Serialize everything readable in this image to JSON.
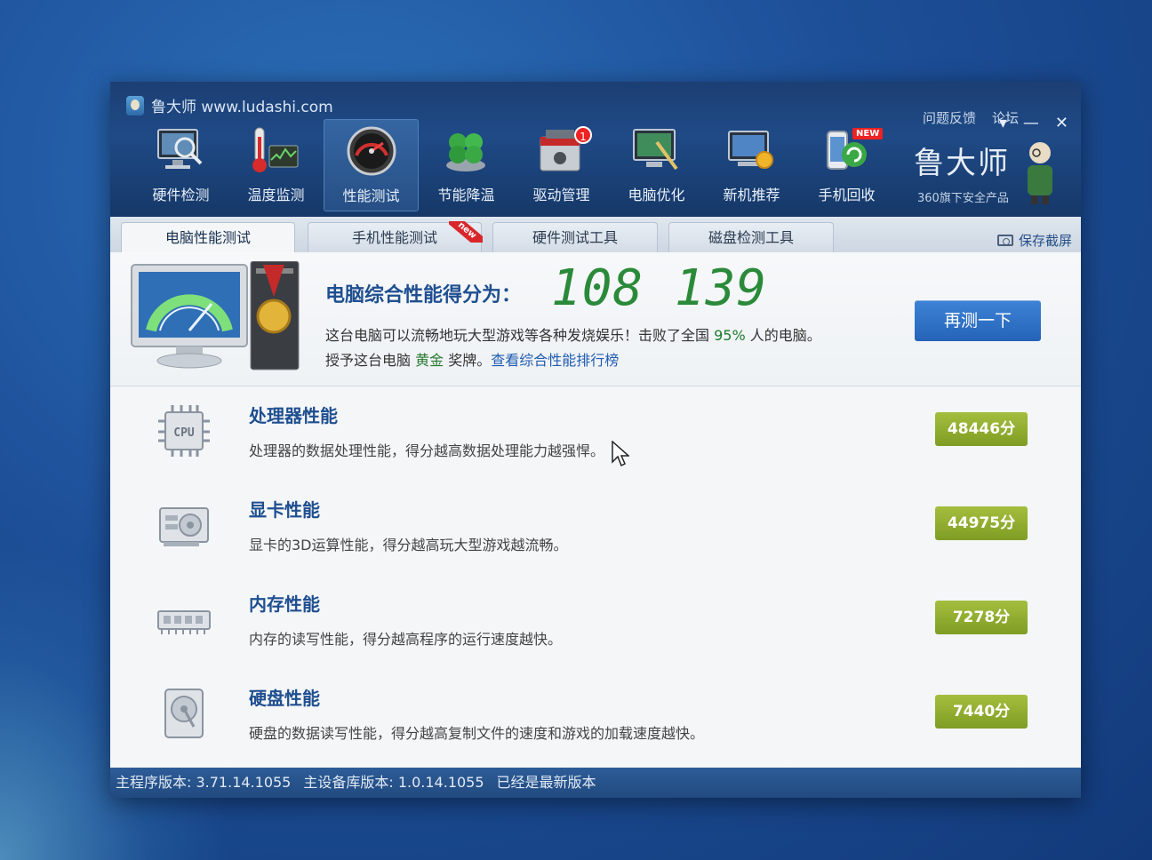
{
  "window": {
    "title": "鲁大师 www.ludashi.com"
  },
  "top_links": {
    "feedback": "问题反馈",
    "forum": "论坛"
  },
  "window_controls": {
    "menu": "▾",
    "minimize": "—",
    "close": "✕"
  },
  "nav": {
    "items": [
      {
        "label": "硬件检测",
        "icon": "hardware-monitor-icon"
      },
      {
        "label": "温度监测",
        "icon": "thermometer-icon"
      },
      {
        "label": "性能测试",
        "icon": "speedometer-icon",
        "active": true
      },
      {
        "label": "节能降温",
        "icon": "clover-leaf-icon"
      },
      {
        "label": "驱动管理",
        "icon": "driver-toolbox-icon",
        "badge": "1"
      },
      {
        "label": "电脑优化",
        "icon": "broom-monitor-icon"
      },
      {
        "label": "新机推荐",
        "icon": "new-pc-medal-icon"
      },
      {
        "label": "手机回收",
        "icon": "phone-recycle-icon",
        "badge": "NEW"
      }
    ]
  },
  "brand": {
    "name": "鲁大师",
    "subtitle": "360旗下安全产品"
  },
  "tabs": [
    {
      "label": "电脑性能测试",
      "active": true
    },
    {
      "label": "手机性能测试",
      "corner": "new"
    },
    {
      "label": "硬件测试工具"
    },
    {
      "label": "磁盘检测工具"
    }
  ],
  "save_screenshot": "保存截屏",
  "summary": {
    "title": "电脑综合性能得分为：",
    "score": "108 139",
    "line1_a": "这台电脑可以流畅地玩大型游戏等各种发烧娱乐！击败了全国",
    "line1_pct": "95%",
    "line1_b": "人的电脑。",
    "line2_a": "授予这台电脑",
    "line2_medal": "黄金",
    "line2_b": "奖牌。",
    "line2_link": "查看综合性能排行榜",
    "retest_button": "再测一下"
  },
  "rows": [
    {
      "title": "处理器性能",
      "desc": "处理器的数据处理性能，得分越高数据处理能力越强悍。",
      "score": "48446分",
      "icon": "cpu-chip-icon",
      "icon_text": "CPU"
    },
    {
      "title": "显卡性能",
      "desc": "显卡的3D运算性能，得分越高玩大型游戏越流畅。",
      "score": "44975分",
      "icon": "graphics-card-icon"
    },
    {
      "title": "内存性能",
      "desc": "内存的读写性能，得分越高程序的运行速度越快。",
      "score": "7278分",
      "icon": "memory-stick-icon"
    },
    {
      "title": "硬盘性能",
      "desc": "硬盘的数据读写性能，得分越高复制文件的速度和游戏的加载速度越快。",
      "score": "7440分",
      "icon": "hard-disk-icon"
    }
  ],
  "status": {
    "main_version": "主程序版本: 3.71.14.1055",
    "db_version": "主设备库版本: 1.0.14.1055",
    "update": "已经是最新版本"
  },
  "colors": {
    "accent": "#1f4f90",
    "score_green": "#2a8a3a",
    "pill_green": "#8fad2e",
    "retest_blue": "#2f72c8"
  }
}
